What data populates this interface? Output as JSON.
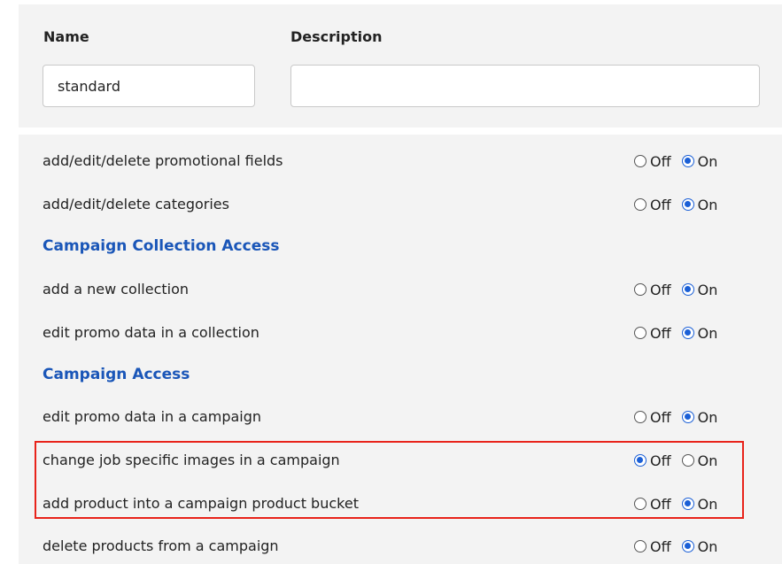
{
  "form": {
    "name_label": "Name",
    "description_label": "Description",
    "name_value": "standard",
    "description_value": ""
  },
  "options": {
    "off_label": "Off",
    "on_label": "On"
  },
  "permissions": {
    "promo_fields": {
      "label": "add/edit/delete promotional fields",
      "value": "On"
    },
    "categories": {
      "label": "add/edit/delete categories",
      "value": "On"
    },
    "collection_section": "Campaign Collection Access",
    "add_collection": {
      "label": "add a new collection",
      "value": "On"
    },
    "edit_promo_collection": {
      "label": "edit promo data in a collection",
      "value": "On"
    },
    "campaign_section": "Campaign Access",
    "edit_promo_campaign": {
      "label": "edit promo data in a campaign",
      "value": "On"
    },
    "change_images": {
      "label": "change job specific images in a campaign",
      "value": "Off"
    },
    "add_product_bucket": {
      "label": "add product into a campaign product bucket",
      "value": "On"
    },
    "delete_products": {
      "label": "delete products from a campaign",
      "value": "On"
    }
  },
  "colors": {
    "section_title": "#1a56b8",
    "radio_checked": "#1a5fd6",
    "highlight": "#e8231a",
    "panel_bg": "#f3f3f3"
  }
}
